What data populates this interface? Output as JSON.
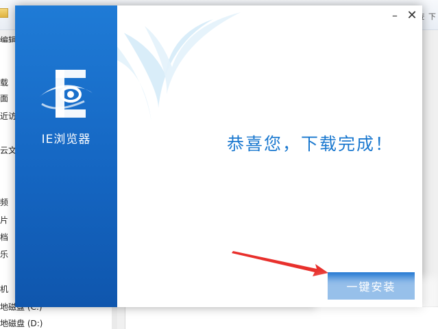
{
  "explorer": {
    "edit_menu": "编辑",
    "top_right_hint": "查 下",
    "nav_items": [
      "载",
      "面",
      "近访",
      "云文",
      "频",
      "片",
      "档",
      "乐",
      "机",
      "地磁盘 (C:)",
      "地磁盘 (D:)"
    ]
  },
  "dialog": {
    "product_name": "IE浏览器",
    "minimize_label": "–",
    "close_label": "✕",
    "success_message": "恭喜您，下载完成！",
    "install_button_label": "一键安装"
  },
  "colors": {
    "sidebar_blue": "#1566c2",
    "accent_blue": "#1a78cf",
    "arrow_red": "#e8302c"
  },
  "icons": {
    "logo": "ie-eye-logo-icon",
    "arrow": "red-arrow-annotation"
  }
}
